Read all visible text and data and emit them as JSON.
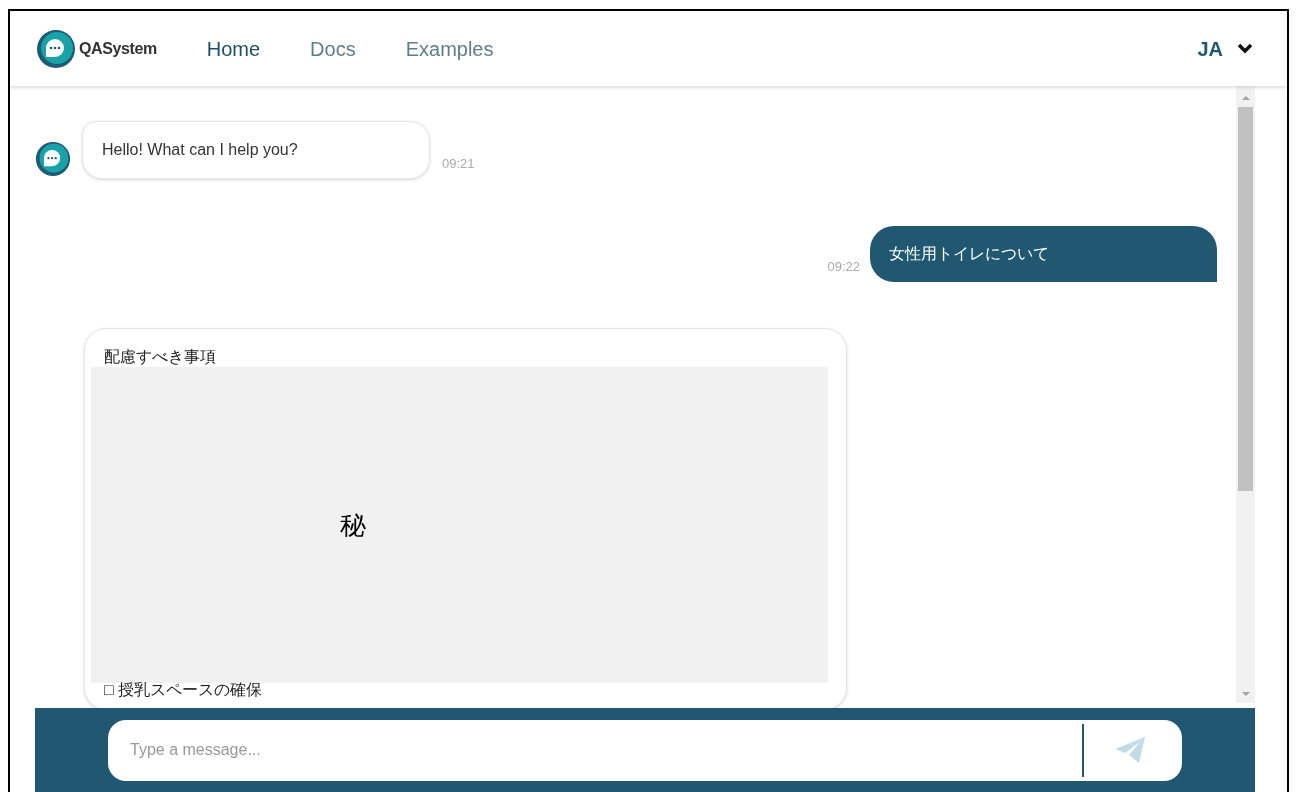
{
  "header": {
    "logo_text": "QASystem",
    "nav": [
      {
        "label": "Home",
        "selected": true
      },
      {
        "label": "Docs",
        "selected": false
      },
      {
        "label": "Examples",
        "selected": false
      }
    ],
    "language": "JA"
  },
  "messages": [
    {
      "kind": "bot",
      "text": "Hello! What can I help you?",
      "time": "09:21"
    },
    {
      "kind": "user",
      "text": "女性用トイレについて",
      "time": "09:22"
    },
    {
      "kind": "card",
      "title": "配慮すべき事項",
      "redacted_mark": "秘",
      "items": [
        "□ 授乳スペースの確保"
      ]
    }
  ],
  "composer": {
    "placeholder": "Type a message..."
  }
}
